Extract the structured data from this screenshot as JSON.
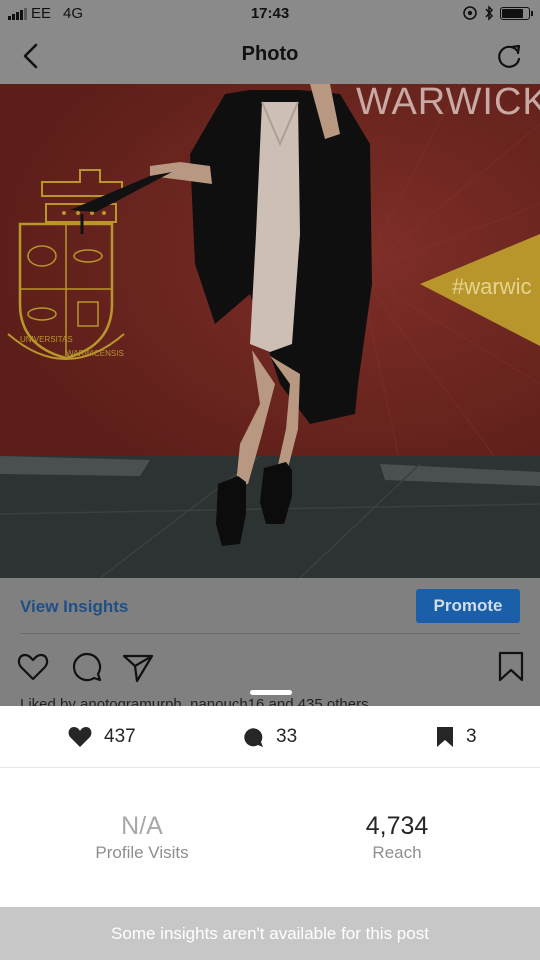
{
  "status_bar": {
    "carrier": "EE",
    "network": "4G",
    "time": "17:43",
    "battery_level": 0.75
  },
  "nav": {
    "title": "Photo",
    "back_icon": "chevron-left-icon",
    "refresh_icon": "refresh-icon"
  },
  "photo": {
    "banner_text": "WARWICK",
    "hashtag": "#warwic",
    "crest_top": "UNIVERSITAS",
    "crest_bottom": "WARWICENSIS"
  },
  "post": {
    "view_insights": "View Insights",
    "promote": "Promote",
    "liked_by": "Liked by anotogramurph, nanouch16 and 435 others"
  },
  "insights": {
    "likes": "437",
    "comments": "33",
    "saves": "3",
    "profile_visits_value": "N/A",
    "profile_visits_label": "Profile Visits",
    "reach_value": "4,734",
    "reach_label": "Reach",
    "notice": "Some insights aren't available for this post"
  },
  "colors": {
    "accent": "#1b5fa8",
    "overlay": "#808080",
    "backdrop_red": "#7a2a23",
    "gold": "#b8962c"
  }
}
